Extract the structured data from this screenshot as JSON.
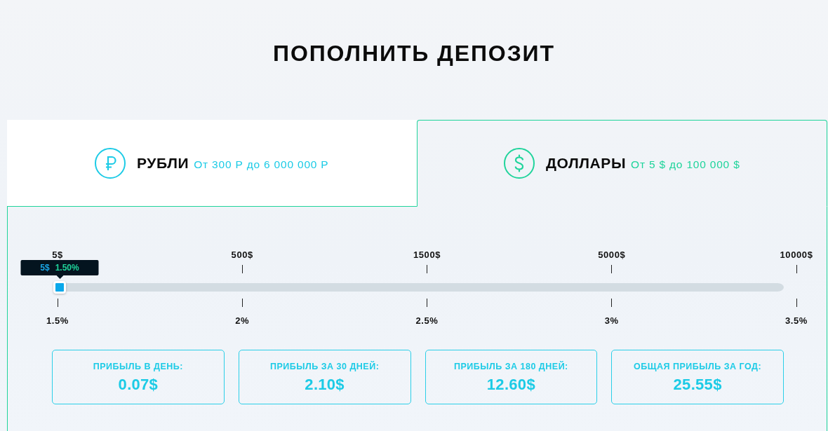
{
  "title": "ПОПОЛНИТЬ ДЕПОЗИТ",
  "tabs": [
    {
      "kind": "ruble",
      "label": "РУБЛИ",
      "range": "От 300 Р до 6 000 000 Р",
      "color": "#1ccbe6",
      "selected": false
    },
    {
      "kind": "dollar",
      "label": "ДОЛЛАРЫ",
      "range": "От 5 $ до 100 000 $",
      "color": "#1fd49b",
      "selected": true
    }
  ],
  "slider": {
    "level": 0,
    "tooltip": {
      "amount": "5$",
      "rate": "1.50%"
    },
    "amount_marks": [
      "5$",
      "500$",
      "1500$",
      "5000$",
      "10000$"
    ],
    "rate_marks": [
      "1.5%",
      "2%",
      "2.5%",
      "3%",
      "3.5%"
    ]
  },
  "stats": [
    {
      "label": "ПРИБЫЛЬ В ДЕНЬ:",
      "value": "0.07$"
    },
    {
      "label": "ПРИБЫЛЬ ЗА 30 ДНЕЙ:",
      "value": "2.10$"
    },
    {
      "label": "ПРИБЫЛЬ ЗА 180 ДНЕЙ:",
      "value": "12.60$"
    },
    {
      "label": "ОБЩАЯ ПРИБЫЛЬ ЗА ГОД:",
      "value": "25.55$"
    }
  ]
}
